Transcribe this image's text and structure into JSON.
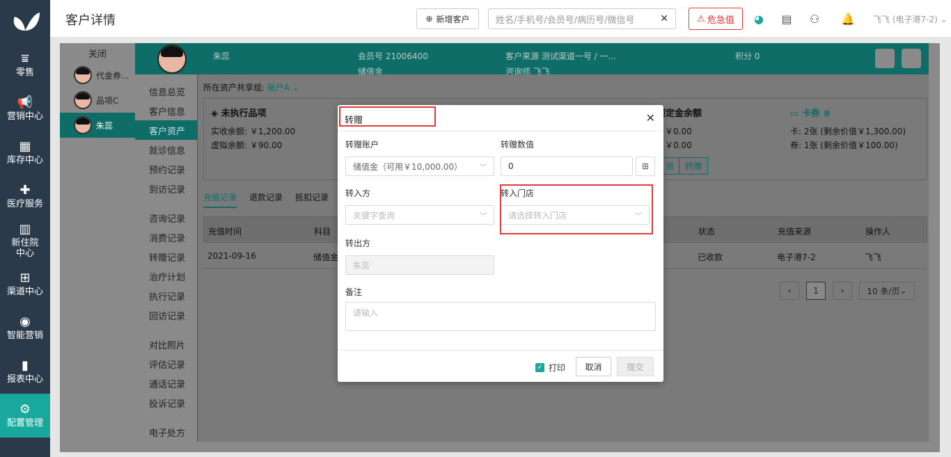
{
  "sidebar": {
    "items": [
      {
        "label": "零售",
        "icon": "retail-icon"
      },
      {
        "label": "营销中心",
        "icon": "megaphone-icon"
      },
      {
        "label": "库存中心",
        "icon": "grid-icon"
      },
      {
        "label": "医疗服务",
        "icon": "medical-kit-icon"
      },
      {
        "label": "新住院中心",
        "icon": "building-icon"
      },
      {
        "label": "渠道中心",
        "icon": "org-chart-icon"
      },
      {
        "label": "智能营销",
        "icon": "smart-marketing-icon"
      },
      {
        "label": "报表中心",
        "icon": "bar-chart-icon"
      },
      {
        "label": "配置管理",
        "icon": "gear-icon"
      }
    ]
  },
  "topbar": {
    "title": "客户详情",
    "new_customer": "新增客户",
    "search_placeholder": "姓名/手机号/会员号/病历号/微信号",
    "danger": "危急值",
    "user_store": "飞飞 (电子港7-2)"
  },
  "customers": {
    "close": "关闭",
    "list": [
      "代金券...",
      "品项C",
      "朱蕊"
    ]
  },
  "header": {
    "name": "朱蕊",
    "member_no": "会员号  21006400",
    "member_type": "储值金",
    "source": "客户来源  测试渠道一号 / 一...",
    "consultant": "咨询师  飞飞",
    "points": "积分  0"
  },
  "submenu": {
    "group1": [
      "信息总览",
      "客户信息",
      "客户资产",
      "就诊信息",
      "预约记录",
      "到访记录"
    ],
    "group2": [
      "咨询记录",
      "消费记录",
      "转赠记录",
      "治疗计划",
      "执行记录",
      "回访记录"
    ],
    "group3": [
      "对比照片",
      "评估记录",
      "通话记录",
      "投诉记录"
    ],
    "group4": [
      "电子处方"
    ]
  },
  "assets": {
    "share_group": "所在资产共享组:",
    "account": "账户A",
    "pending_title": "未执行品项",
    "actual_balance": "实收余额: ￥1,200.00",
    "virtual_balance": "虚拟余额: ￥90.00",
    "deposit_title": "预定金余额",
    "deposit_1": "￥0.00",
    "deposit_2": "￥0.00",
    "btn_stored": "值",
    "btn_transfer": "转赠",
    "card_title": "卡券",
    "card_line": "卡:  2张 (剩余价值￥1,300.00)",
    "coupon_line": "券:  1张 (剩余价值￥100.00)"
  },
  "tabs": [
    "充值记录",
    "退款记录",
    "抵扣记录"
  ],
  "table": {
    "headers": [
      "充值时间",
      "科目",
      "状态",
      "充值来源",
      "操作人"
    ],
    "row": [
      "2021-09-16",
      "储值金",
      "已收款",
      "电子港7-2",
      "飞飞"
    ]
  },
  "pager": {
    "page": "1",
    "size": "10 条/页"
  },
  "modal": {
    "title": "转赠",
    "account_label": "转赠账户",
    "account_value": "储值金（可用￥10,000.00）",
    "amount_label": "转赠数值",
    "amount_value": "0",
    "to_label": "转入方",
    "to_placeholder": "关键字查询",
    "store_label": "转入门店",
    "store_placeholder": "请选择转入门店",
    "from_label": "转出方",
    "from_value": "朱蕊",
    "remark_label": "备注",
    "remark_placeholder": "请输入",
    "print": "打印",
    "cancel": "取消",
    "submit": "提交"
  }
}
